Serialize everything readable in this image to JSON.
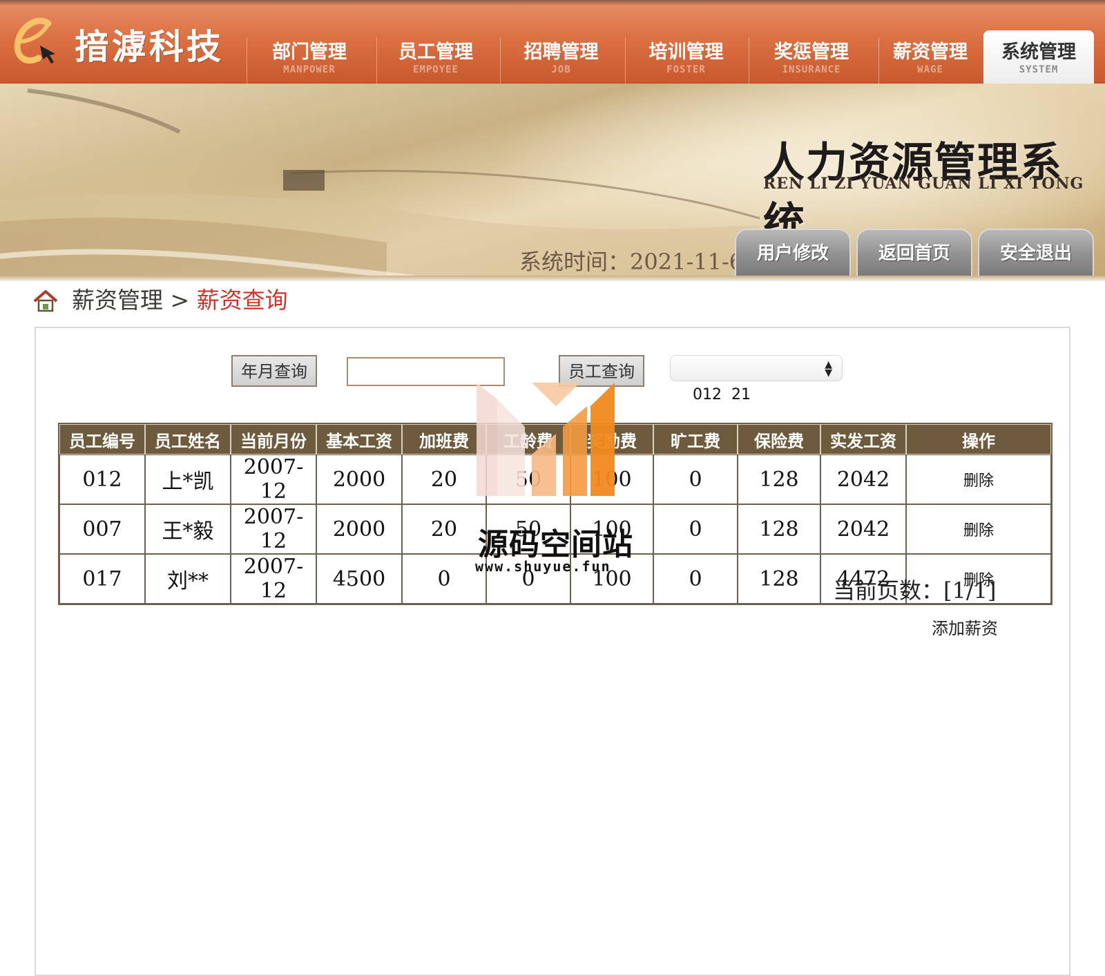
{
  "brand": {
    "name": "揞滹科技"
  },
  "nav": {
    "items": [
      {
        "cn": "部门管理",
        "en": "MANPOWER"
      },
      {
        "cn": "员工管理",
        "en": "EMPOYEE"
      },
      {
        "cn": "招聘管理",
        "en": "JOB"
      },
      {
        "cn": "培训管理",
        "en": "FOSTER"
      },
      {
        "cn": "奖惩管理",
        "en": "INSURANCE"
      },
      {
        "cn": "薪资管理",
        "en": "WAGE"
      },
      {
        "cn": "系统管理",
        "en": "SYSTEM"
      }
    ],
    "active_index": 6
  },
  "banner": {
    "title": "人力资源管理系统",
    "subtitle": "REN LI ZI YUAN GUAN LI XI TONG",
    "system_time_label": "系统时间：",
    "system_time_value": "2021-11-6",
    "buttons": {
      "edit_user": "用户修改",
      "home": "返回首页",
      "logout": "安全退出"
    }
  },
  "breadcrumb": {
    "parent": "薪资管理",
    "separator": ">",
    "current": "薪资查询"
  },
  "query": {
    "month_button": "年月查询",
    "month_input_value": "",
    "employee_button": "员工查询",
    "employee_select_value": "012  21"
  },
  "table": {
    "headers": [
      "员工编号",
      "员工姓名",
      "当前月份",
      "基本工资",
      "加班费",
      "工龄费",
      "奖励费",
      "旷工费",
      "保险费",
      "实发工资",
      "操作"
    ],
    "rows": [
      [
        "012",
        "上*凯",
        "2007-12",
        "2000",
        "20",
        "50",
        "100",
        "0",
        "128",
        "2042",
        "删除"
      ],
      [
        "007",
        "王*毅",
        "2007-12",
        "2000",
        "20",
        "50",
        "100",
        "0",
        "128",
        "2042",
        "删除"
      ],
      [
        "017",
        "刘**",
        "2007-12",
        "4500",
        "0",
        "0",
        "100",
        "0",
        "128",
        "4472",
        "删除"
      ]
    ]
  },
  "pager": {
    "label": "当前页数：",
    "value": "[1/1]"
  },
  "add_link": "添加薪资",
  "watermark": {
    "text": "源码空间站",
    "url": "www.shuyue.fun"
  },
  "colors": {
    "nav": "#dc7143",
    "table_header": "#6e5a3c",
    "breadcrumb_current": "#d2322a",
    "watermark_orange": "#f08a1c"
  }
}
